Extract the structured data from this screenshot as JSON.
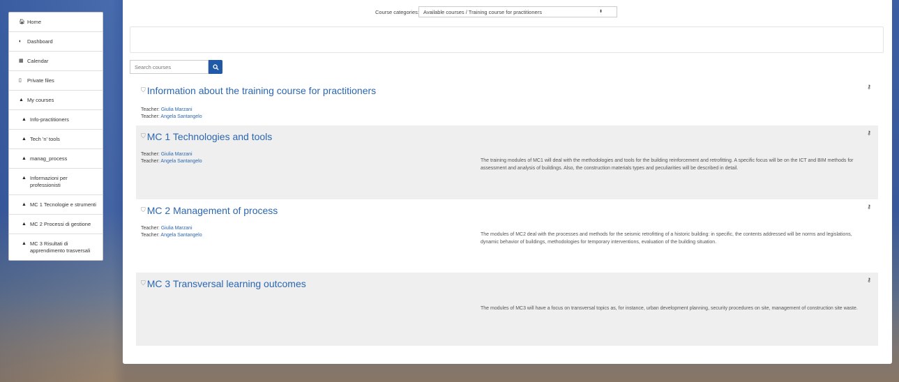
{
  "sidebar": {
    "items": [
      {
        "icon": "home-icon",
        "glyph": "🏠︎",
        "label": "Home"
      },
      {
        "icon": "dashboard-icon",
        "glyph": "◐",
        "label": "Dashboard"
      },
      {
        "icon": "calendar-icon",
        "glyph": "▦",
        "label": "Calendar"
      },
      {
        "icon": "file-icon",
        "glyph": "▯",
        "label": "Private files"
      },
      {
        "icon": "graduation-cap-icon",
        "glyph": "▲",
        "label": "My courses"
      },
      {
        "icon": "graduation-cap-icon",
        "glyph": "▲",
        "label": "Info-practitioners"
      },
      {
        "icon": "graduation-cap-icon",
        "glyph": "▲",
        "label": "Tech 'n' tools"
      },
      {
        "icon": "graduation-cap-icon",
        "glyph": "▲",
        "label": "manag_process"
      },
      {
        "icon": "graduation-cap-icon",
        "glyph": "▲",
        "label": "Informazioni per professionisti"
      },
      {
        "icon": "graduation-cap-icon",
        "glyph": "▲",
        "label": "MC 1 Tecnologie e strumenti"
      },
      {
        "icon": "graduation-cap-icon",
        "glyph": "▲",
        "label": "MC 2 Processi di gestione"
      },
      {
        "icon": "graduation-cap-icon",
        "glyph": "▲",
        "label": "MC 3 Risultati di apprendimento trasversali"
      }
    ]
  },
  "category": {
    "label": "Course categories:",
    "selected": "Available courses / Training course for practitioners"
  },
  "search": {
    "placeholder": "Search courses"
  },
  "teacher_label": "Teacher:",
  "courses": [
    {
      "title": "Information about the training course for practitioners",
      "teachers": [
        "Giulia Marzani",
        "Angela Santangelo"
      ],
      "summary": ""
    },
    {
      "title": "MC 1 Technologies and tools",
      "teachers": [
        "Giulia Marzani",
        "Angela Santangelo"
      ],
      "summary": "The training modules of MC1 will deal with the methodologies and tools for the building reinforcement and retrofitting. A specific focus will be on the ICT and BIM methods for assessment and analysis of buildings. Also, the construction materials types and peculiarities will be described in detail."
    },
    {
      "title": "MC 2 Management of process",
      "teachers": [
        "Giulia Marzani",
        "Angela Santangelo"
      ],
      "summary": "The modules of MC2 deal with the processes and methods for the seismic retrofitting of a historic building: in specific, the contents addressed will be norms and legislations, dynamic behavior of buildings, methodologies for temporary interventions, evaluation of the building situation."
    },
    {
      "title": "MC 3 Transversal learning outcomes",
      "teachers": [],
      "summary": "The modules of MC3 will have a focus on transversal topics as, for instance, urban development planning, security procedures on site, management of construction site waste."
    }
  ]
}
